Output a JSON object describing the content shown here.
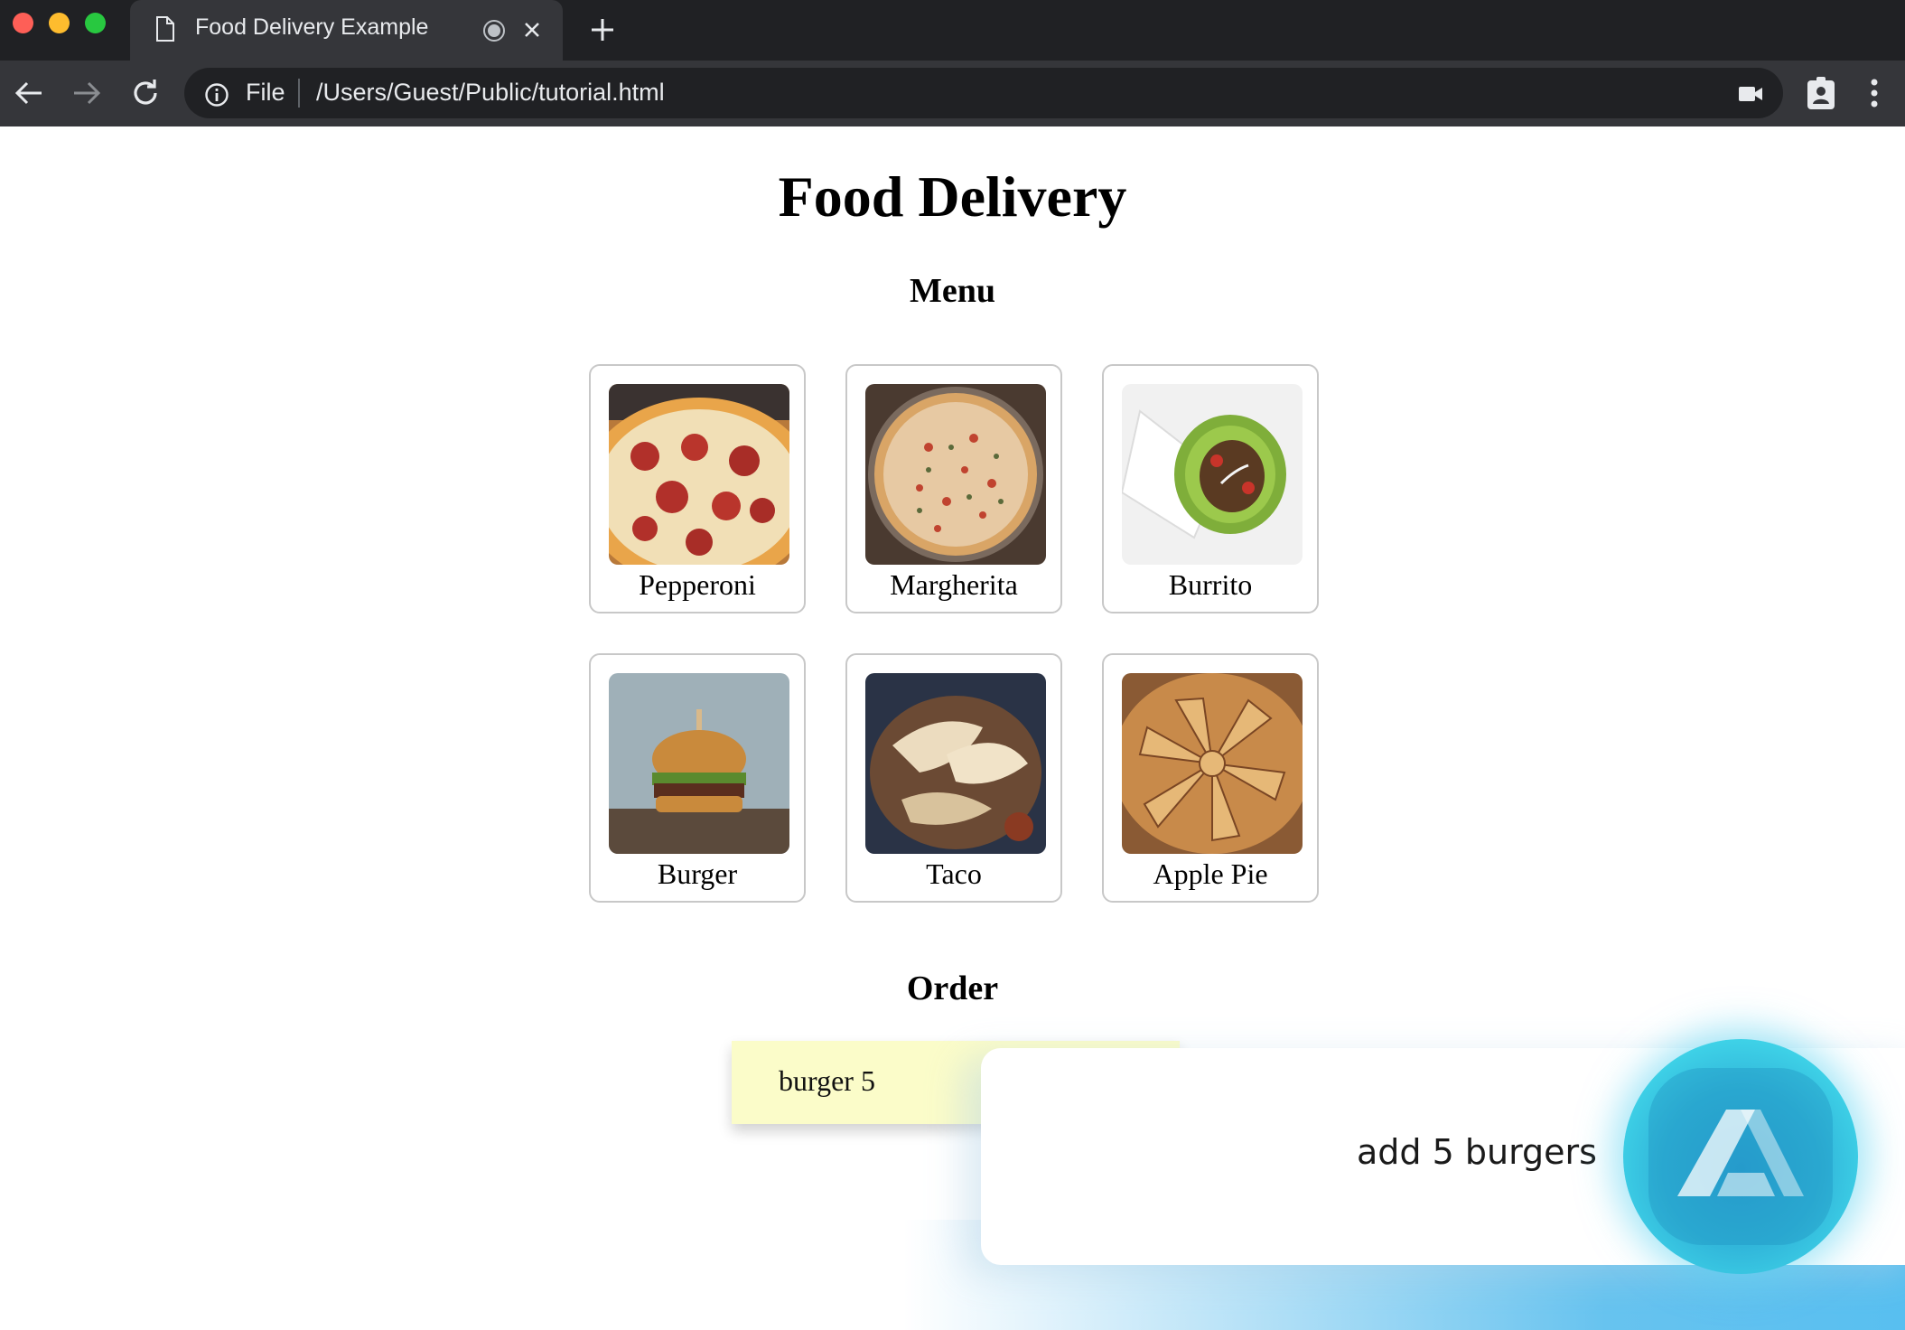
{
  "browser": {
    "tab_title": "Food Delivery Example",
    "address_scheme": "File",
    "address_url": "/Users/Guest/Public/tutorial.html"
  },
  "page": {
    "title": "Food Delivery",
    "menu_heading": "Menu",
    "order_heading": "Order"
  },
  "menu": {
    "items": [
      {
        "label": "Pepperoni",
        "image": "pepperoni-pizza-photo"
      },
      {
        "label": "Margherita",
        "image": "margherita-pizza-photo"
      },
      {
        "label": "Burrito",
        "image": "burrito-photo"
      },
      {
        "label": "Burger",
        "image": "burger-photo"
      },
      {
        "label": "Taco",
        "image": "taco-photo"
      },
      {
        "label": "Apple Pie",
        "image": "apple-pie-photo"
      }
    ]
  },
  "order": {
    "text": "burger 5"
  },
  "assistant": {
    "text": "add 5 burgers",
    "accent": "#31b6da"
  }
}
